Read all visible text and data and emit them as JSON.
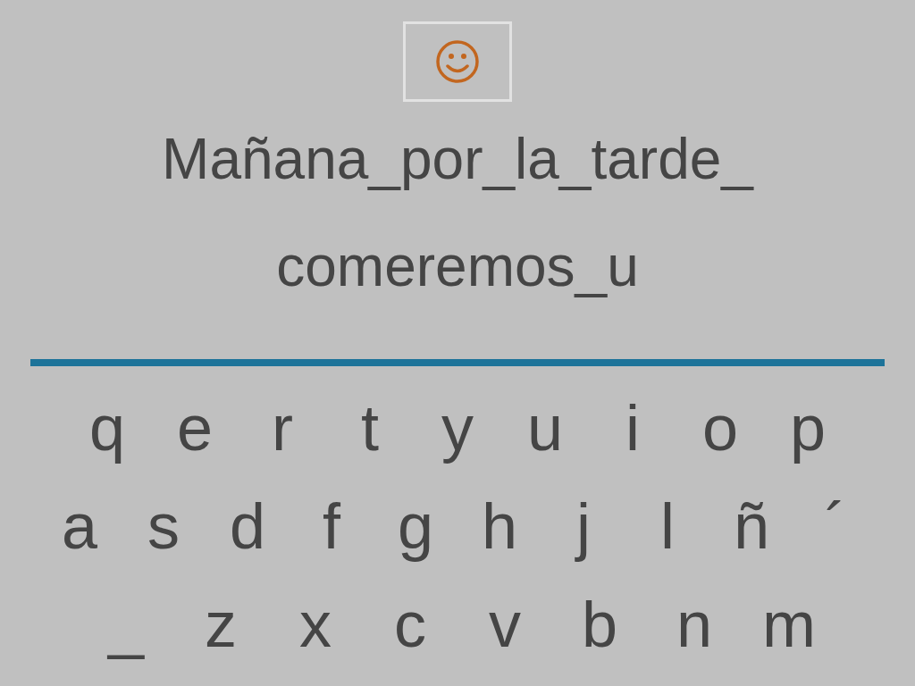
{
  "sentence_lines": [
    "Mañana_por_la_tarde_",
    "comeremos_u"
  ],
  "keyboard": {
    "rows": [
      [
        "q",
        "e",
        "r",
        "t",
        "y",
        "u",
        "i",
        "o",
        "p"
      ],
      [
        "a",
        "s",
        "d",
        "f",
        "g",
        "h",
        "j",
        "l",
        "ñ",
        "´"
      ],
      [
        "_",
        "z",
        "x",
        "c",
        "v",
        "b",
        "n",
        "m"
      ]
    ]
  }
}
